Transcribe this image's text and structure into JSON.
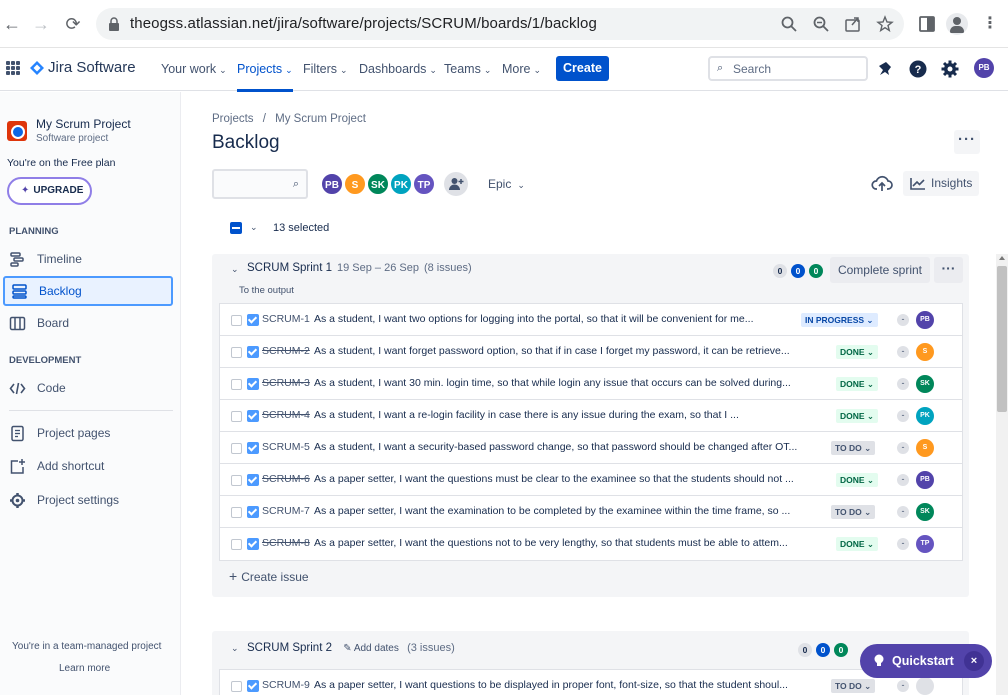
{
  "browser": {
    "url": "theogss.atlassian.net/jira/software/projects/SCRUM/boards/1/backlog"
  },
  "topnav": {
    "app_name": "Jira Software",
    "menus": [
      "Your work",
      "Projects",
      "Filters",
      "Dashboards",
      "Teams",
      "More"
    ],
    "active_menu": "Projects",
    "create_label": "Create",
    "search_placeholder": "Search",
    "user_initials": "PB"
  },
  "sidebar": {
    "project_name": "My Scrum Project",
    "project_type": "Software project",
    "plan_text": "You're on the Free plan",
    "upgrade_label": "UPGRADE",
    "planning_heading": "PLANNING",
    "planning_items": [
      "Timeline",
      "Backlog",
      "Board"
    ],
    "selected_item": "Backlog",
    "development_heading": "DEVELOPMENT",
    "development_items": [
      "Code"
    ],
    "other_items": [
      "Project pages",
      "Add shortcut",
      "Project settings"
    ],
    "team_managed_text": "You're in a team-managed project",
    "learn_more": "Learn more"
  },
  "main": {
    "breadcrumb_projects": "Projects",
    "breadcrumb_sep": "/",
    "breadcrumb_project": "My Scrum Project",
    "title": "Backlog",
    "avatars": [
      {
        "initials": "PB",
        "color": "#5243aa"
      },
      {
        "initials": "S",
        "color": "#ff991f"
      },
      {
        "initials": "SK",
        "color": "#00875a"
      },
      {
        "initials": "PK",
        "color": "#00a3bf"
      },
      {
        "initials": "TP",
        "color": "#6554c0"
      }
    ],
    "epic_label": "Epic",
    "insights_label": "Insights",
    "selected_text": "13 selected"
  },
  "sprint1": {
    "name": "SCRUM Sprint 1",
    "dates": "19 Sep – 26 Sep",
    "count": "(8 issues)",
    "goal": "To the output",
    "counts": {
      "todo": "0",
      "inprogress": "0",
      "done": "0"
    },
    "complete_label": "Complete sprint",
    "create_issue_label": "Create issue",
    "issues": [
      {
        "key": "SCRUM-1",
        "done": false,
        "summary": "As a student, I want two options for logging into the portal, so that it will be convenient for me...",
        "status": "IN PROGRESS",
        "status_type": "inprogress",
        "assignee": "PB",
        "assignee_color": "#5243aa"
      },
      {
        "key": "SCRUM-2",
        "done": true,
        "summary": "As a student, I want forget password option, so that if in case I forget my password, it can be retrieve...",
        "status": "DONE",
        "status_type": "done",
        "assignee": "S",
        "assignee_color": "#ff991f"
      },
      {
        "key": "SCRUM-3",
        "done": true,
        "summary": "As a student, I want 30 min. login time, so that while login any issue that occurs can be solved during...",
        "status": "DONE",
        "status_type": "done",
        "assignee": "SK",
        "assignee_color": "#00875a"
      },
      {
        "key": "SCRUM-4",
        "done": true,
        "summary": "As a student, I want a re-login facility in case there is any issue during the exam, so that I ...",
        "status": "DONE",
        "status_type": "done",
        "assignee": "PK",
        "assignee_color": "#00a3bf"
      },
      {
        "key": "SCRUM-5",
        "done": false,
        "summary": "As a student, I want a security-based password change, so that password should be changed after OT...",
        "status": "TO DO",
        "status_type": "todo",
        "assignee": "S",
        "assignee_color": "#ff991f"
      },
      {
        "key": "SCRUM-6",
        "done": true,
        "summary": "As a paper setter, I want the questions must be clear to the examinee so that the students should not ...",
        "status": "DONE",
        "status_type": "done",
        "assignee": "PB",
        "assignee_color": "#5243aa"
      },
      {
        "key": "SCRUM-7",
        "done": false,
        "summary": "As a paper setter, I want the examination to be completed by the examinee within the time frame, so ...",
        "status": "TO DO",
        "status_type": "todo",
        "assignee": "SK",
        "assignee_color": "#00875a"
      },
      {
        "key": "SCRUM-8",
        "done": true,
        "summary": "As a paper setter, I want the questions not to be very lengthy, so that students must be able to attem...",
        "status": "DONE",
        "status_type": "done",
        "assignee": "TP",
        "assignee_color": "#6554c0"
      }
    ]
  },
  "sprint2": {
    "name": "SCRUM Sprint 2",
    "add_dates": "Add dates",
    "count": "(3 issues)",
    "counts": {
      "todo": "0",
      "inprogress": "0",
      "done": "0"
    },
    "issues": [
      {
        "key": "SCRUM-9",
        "done": false,
        "summary": "As a paper setter, I want questions to be displayed in proper font, font-size, so that the student shoul...",
        "status": "TO DO",
        "status_type": "todo",
        "assignee": "",
        "assignee_color": "#dfe1e6"
      }
    ]
  },
  "quickstart": {
    "label": "Quickstart",
    "close": "×"
  }
}
